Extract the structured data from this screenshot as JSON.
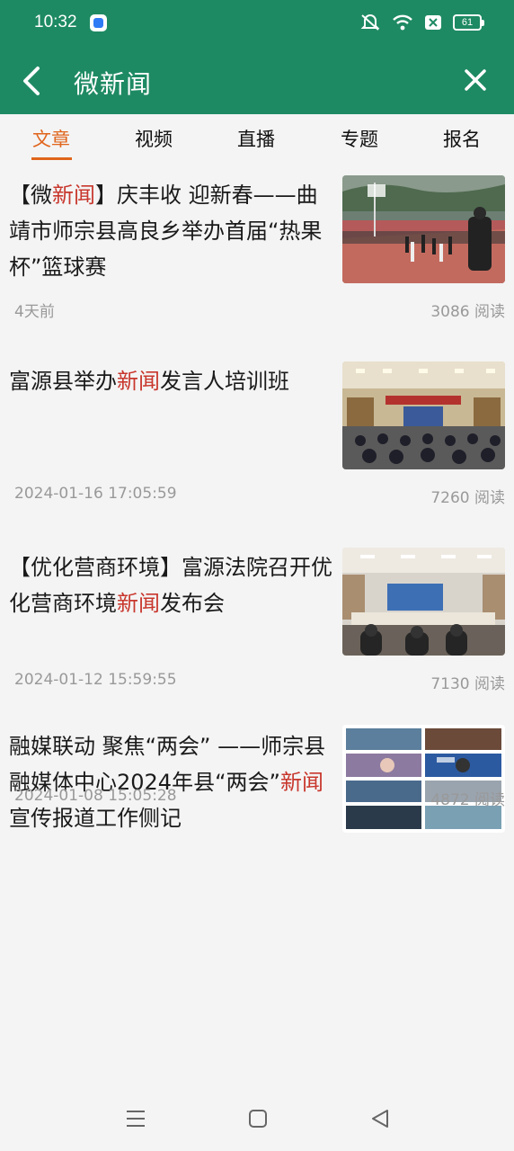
{
  "status": {
    "time": "10:32",
    "battery": "61"
  },
  "header": {
    "title": "微新闻"
  },
  "tabs": [
    {
      "label": "文章",
      "active": true
    },
    {
      "label": "视频",
      "active": false
    },
    {
      "label": "直播",
      "active": false
    },
    {
      "label": "专题",
      "active": false
    },
    {
      "label": "报名",
      "active": false
    }
  ],
  "articles": [
    {
      "title_parts": [
        "【微",
        "新闻",
        "】庆丰收 迎新春——曲靖市师宗县高良乡举办首届“热果杯”篮球赛"
      ],
      "date": "4天前",
      "reads": "3086 阅读",
      "thumb": "basketball-court-photo"
    },
    {
      "title_parts": [
        "富源县举办",
        "新闻",
        "发言人培训班"
      ],
      "date": "2024-01-16 17:05:59",
      "reads": "7260 阅读",
      "thumb": "conference-hall-photo"
    },
    {
      "title_parts": [
        "【优化营商环境】富源法院召开优化营商环境",
        "新闻",
        "发布会"
      ],
      "date": "2024-01-12 15:59:55",
      "reads": "7130 阅读",
      "thumb": "meeting-room-photo"
    },
    {
      "title_parts": [
        "融媒联动 聚焦“两会” ——师宗县融媒体中心2024年县“两会”",
        "新闻",
        "宣传报道工作侧记"
      ],
      "date": "2024-01-08 15:05:28",
      "reads": "4872 阅读",
      "thumb": "photo-collage"
    }
  ],
  "colors": {
    "header": "#1e8a63",
    "accent": "#e0651c",
    "highlight": "#c8372d"
  }
}
